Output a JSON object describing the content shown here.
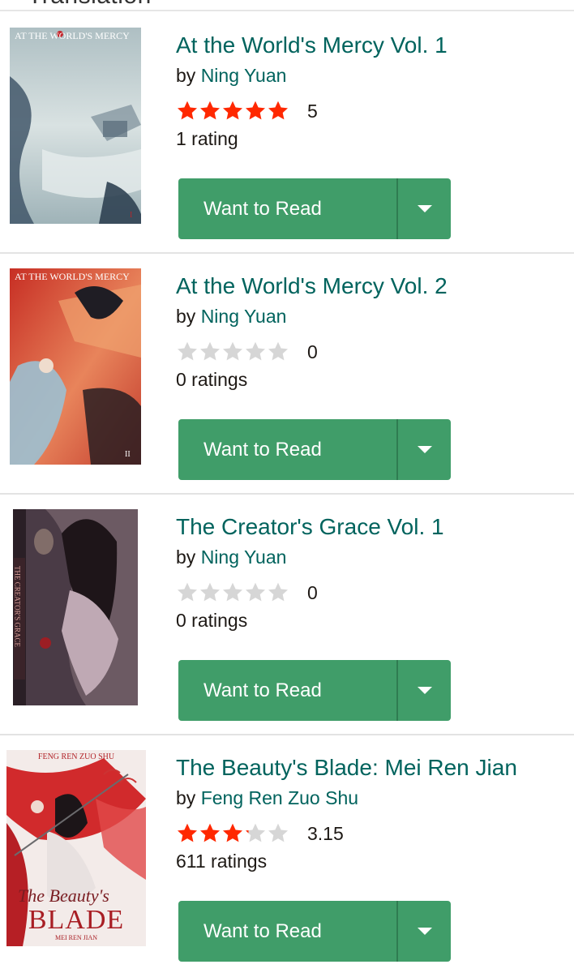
{
  "header": {
    "title": "Translation"
  },
  "books": [
    {
      "title": "At the World's Mercy Vol. 1",
      "by": "by",
      "author": "Ning Yuan",
      "stars_filled": 5,
      "avg": "5",
      "count": "1 rating",
      "button": "Want to Read",
      "cover_text": "AT THE WORLD'S MERCY",
      "cover_colors": [
        "#cdd9d9",
        "#8fa7ad",
        "#3f5563"
      ]
    },
    {
      "title": "At the World's Mercy Vol. 2",
      "by": "by",
      "author": "Ning Yuan",
      "stars_filled": 0,
      "avg": "0",
      "count": "0 ratings",
      "button": "Want to Read",
      "cover_text": "AT THE WORLD'S MERCY",
      "cover_colors": [
        "#c9322a",
        "#e07a52",
        "#7aa5b8"
      ]
    },
    {
      "title": "The Creator's Grace Vol. 1",
      "by": "by",
      "author": "Ning Yuan",
      "stars_filled": 0,
      "avg": "0",
      "count": "0 ratings",
      "button": "Want to Read",
      "cover_text": "THE CREATOR'S GRACE",
      "cover_colors": [
        "#2b2430",
        "#7d6f73",
        "#c9a8a4"
      ]
    },
    {
      "title": "The Beauty's Blade: Mei Ren Jian",
      "by": "by",
      "author": "Feng Ren Zuo Shu",
      "stars_filled": 3.15,
      "avg": "3.15",
      "count": "611 ratings",
      "button": "Want to Read",
      "cover_text": "BLADE",
      "cover_text_top": "FENG REN ZUO SHU",
      "cover_text_sub": "MEI REN JIAN",
      "cover_text_script": "The Beauty's",
      "cover_colors": [
        "#f1e7e6",
        "#d8262a",
        "#a71c22"
      ]
    }
  ],
  "colors": {
    "star_filled": "#ff2800",
    "star_empty": "#d6d6d6",
    "button": "#409d69",
    "link": "#00635d"
  }
}
